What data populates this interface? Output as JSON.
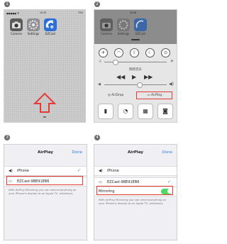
{
  "steps": [
    "1",
    "2",
    "3",
    "4"
  ],
  "panel1": {
    "status_left": "●●●●● 令",
    "status_time": "10:35",
    "status_right": "75%",
    "apps": [
      {
        "label": "Camera",
        "icon": "camera-icon",
        "color": "#5b5b5b"
      },
      {
        "label": "Settings",
        "icon": "settings-icon",
        "color": "#8e8e93"
      },
      {
        "label": "EZCast",
        "icon": "ezcast-icon",
        "color": "#2d6fd6"
      }
    ],
    "arrow_color": "#e53935"
  },
  "panel2": {
    "status_time": "10:36",
    "apps": [
      {
        "label": "Camera",
        "icon": "camera-icon"
      },
      {
        "label": "Settings",
        "icon": "settings-icon"
      },
      {
        "label": "EZCast",
        "icon": "ezcast-icon"
      }
    ],
    "now_playing": "网络音乐",
    "airdrop_label": "AirDrop",
    "airplay_label": "AirPlay"
  },
  "panel3": {
    "title": "AirPlay",
    "done": "Done",
    "iphone_label": "iPhone",
    "device_label": "EZCast-9BE91EB6",
    "note": "With AirPlay Mirroring you can send everything on your iPhone's display to an Apple TV, wirelessly."
  },
  "panel4": {
    "title": "AirPlay",
    "done": "Done",
    "iphone_label": "iPhone",
    "device_label": "EZCast-9BE91EB6",
    "mirroring_label": "Mirroring",
    "note": "With AirPlay Mirroring you can send everything on your iPhone's display to an Apple TV, wirelessly."
  }
}
